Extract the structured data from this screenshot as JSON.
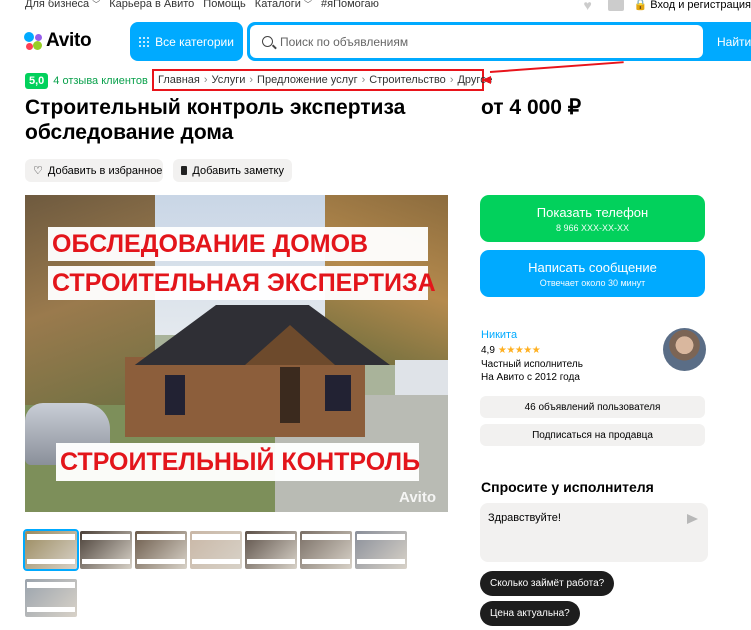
{
  "topbar": {
    "links": [
      "Для бизнеса",
      "Карьера в Авито",
      "Помощь",
      "Каталоги",
      "#яПомогаю"
    ],
    "login_label": "Вход и регистрация"
  },
  "header": {
    "logo_text": "Avito",
    "categories_label": "Все категории",
    "search_placeholder": "Поиск по объявлениям",
    "find_label": "Найти"
  },
  "rating": {
    "score": "5,0",
    "reviews_label": "4 отзыва клиентов"
  },
  "breadcrumb": [
    "Главная",
    "Услуги",
    "Предложение услуг",
    "Строительство",
    "Другое"
  ],
  "listing": {
    "title": "Строительный контроль экспертиза обследование дома",
    "price": "от 4 000 ₽",
    "favorite_label": "Добавить в избранное",
    "note_label": "Добавить заметку"
  },
  "photo": {
    "label_1": "ОБСЛЕДОВАНИЕ ДОМОВ",
    "label_2": "СТРОИТЕЛЬНАЯ ЭКСПЕРТИЗА",
    "label_3": "СТРОИТЕЛЬНЫЙ КОНТРОЛЬ",
    "watermark": "Avito"
  },
  "thumbnails": {
    "count": 8,
    "selected_index": 0,
    "colors": [
      "#9a8a5e",
      "#4a4038",
      "#6b5a4a",
      "#c9b7a6",
      "#5c5048",
      "#7a6f66",
      "#8a8f9a",
      "#9aa3ad"
    ]
  },
  "actions": {
    "phone_label": "Показать телефон",
    "phone_number": "8 966 XXX-XX-XX",
    "message_label": "Написать сообщение",
    "message_sub": "Отвечает около 30 минут"
  },
  "seller": {
    "name": "Никита",
    "rating": "4,9",
    "stars": "★★★★★",
    "type": "Частный исполнитель",
    "since": "На Авито с 2012 года",
    "ads_label": "46 объявлений пользователя",
    "subscribe_label": "Подписаться на продавца"
  },
  "ask": {
    "title": "Спросите у исполнителя",
    "message_value": "Здравствуйте!",
    "chips": [
      "Сколько займёт работа?",
      "Цена актуальна?"
    ]
  },
  "colors": {
    "brand_blue": "#00aaff",
    "green": "#02d15c",
    "annotation_red": "#e8141b"
  }
}
